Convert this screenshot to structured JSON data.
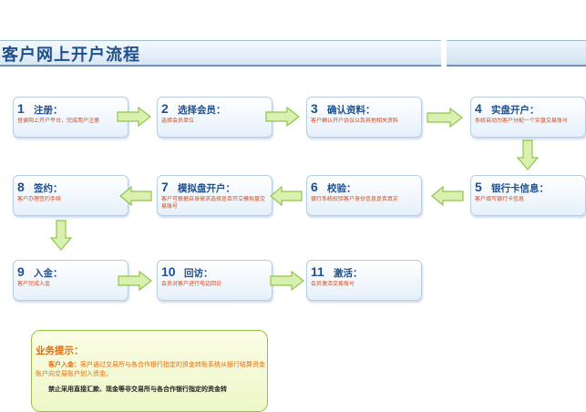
{
  "header": {
    "title": "客户网上开户流程"
  },
  "steps": [
    {
      "num": "1",
      "title": "注册",
      "suffix": "：",
      "desc": "登录网上开户平台，完成用户注册"
    },
    {
      "num": "2",
      "title": "选择会员",
      "suffix": "：",
      "desc": "选择会员单位"
    },
    {
      "num": "3",
      "title": "确认资料",
      "suffix": "：",
      "desc": "客户确认开户协议以及其他相关资料"
    },
    {
      "num": "4",
      "title": "实盘开户",
      "suffix": "：",
      "desc": "系统自动为客户分配一个实盘交易账号"
    },
    {
      "num": "5",
      "title": "银行卡信息",
      "suffix": "：",
      "desc": "客户填写银行卡信息"
    },
    {
      "num": "6",
      "title": "校验",
      "suffix": "：",
      "desc": "银行系统校验客户身份信息是否真实"
    },
    {
      "num": "7",
      "title": "模拟盘开户",
      "suffix": "：",
      "desc": "客户可根据自身需求选择是否开立模拟盘交易账号"
    },
    {
      "num": "8",
      "title": "签约",
      "suffix": "：",
      "desc": "客户办理签约手续"
    },
    {
      "num": "9",
      "title": "入金",
      "suffix": "：",
      "desc": "客户完成入金"
    },
    {
      "num": "10",
      "title": "回访",
      "suffix": "：",
      "desc": "会员对客户进行电话回访"
    },
    {
      "num": "11",
      "title": "激活",
      "suffix": "：",
      "desc": "会员激活交易账号"
    }
  ],
  "tips": {
    "title": "业务提示：",
    "label": "客户入金：",
    "line1": "客户通过交易所与各合作银行指定的资金转账系统从银行结算资金账户向交易账户划入资金。",
    "line2": "禁止采用直接汇款、现金等非交易所与各合作银行指定的资金转"
  },
  "colors": {
    "title": "#1f4f8c",
    "desc": "#d2471a",
    "arrow_fill": "#d9f0b0",
    "arrow_stroke": "#8fc64a",
    "tips_text": "#e06d10"
  }
}
